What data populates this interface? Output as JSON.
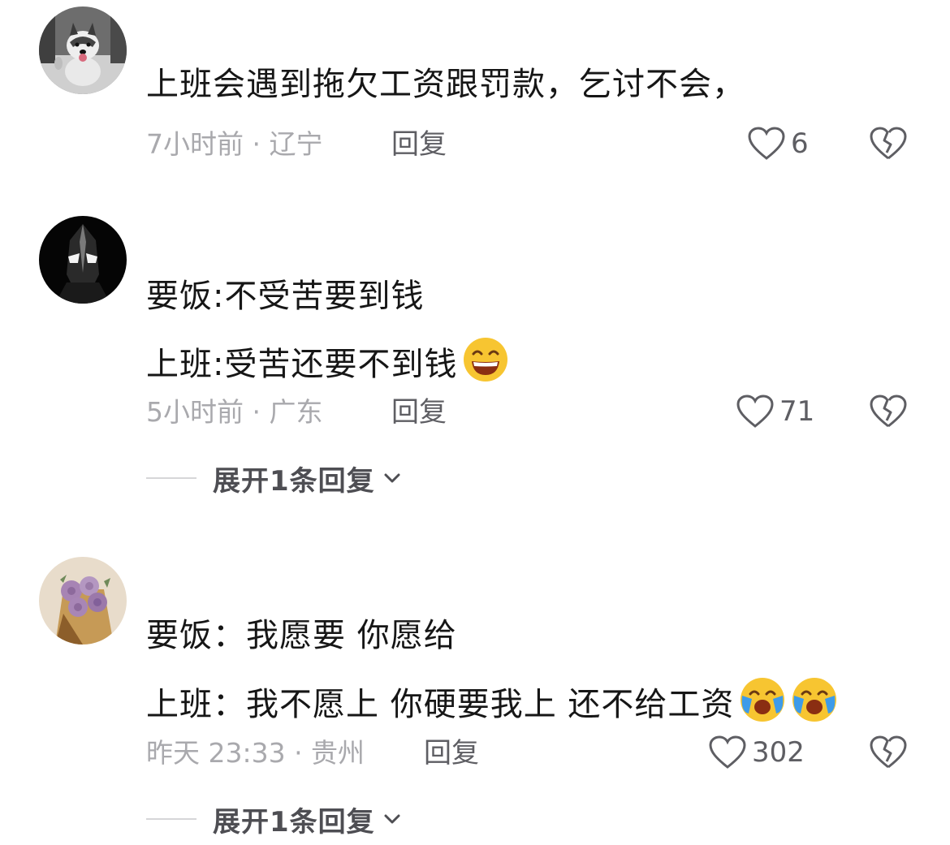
{
  "comments": [
    {
      "avatar_icon": "husky-dog-avatar",
      "lines": [
        "上班会遇到拖欠工资跟罚款，乞讨不会，"
      ],
      "time_location": "7小时前 · 辽宁",
      "reply_label": "回复",
      "like_count": "6"
    },
    {
      "avatar_icon": "ultraman-avatar",
      "lines": [
        "要饭:不受苦要到钱",
        "上班:受苦还要不到钱"
      ],
      "emojis": [
        "grin-emoji"
      ],
      "time_location": "5小时前 · 广东",
      "reply_label": "回复",
      "like_count": "71",
      "expand_label": "展开1条回复"
    },
    {
      "avatar_icon": "purple-roses-avatar",
      "lines": [
        "要饭：我愿要 你愿给",
        "上班：我不愿上  你硬要我上 还不给工资"
      ],
      "emojis": [
        "crying-laughing-emoji",
        "crying-laughing-emoji"
      ],
      "time_location": "昨天 23:33 · 贵州",
      "reply_label": "回复",
      "like_count": "302",
      "expand_label": "展开1条回复"
    }
  ],
  "colors": {
    "meta_text": "#a9a9ad",
    "action_text": "#5e5e63",
    "emoji_yellow": "#f7c531",
    "tear_blue": "#3d9be9"
  }
}
